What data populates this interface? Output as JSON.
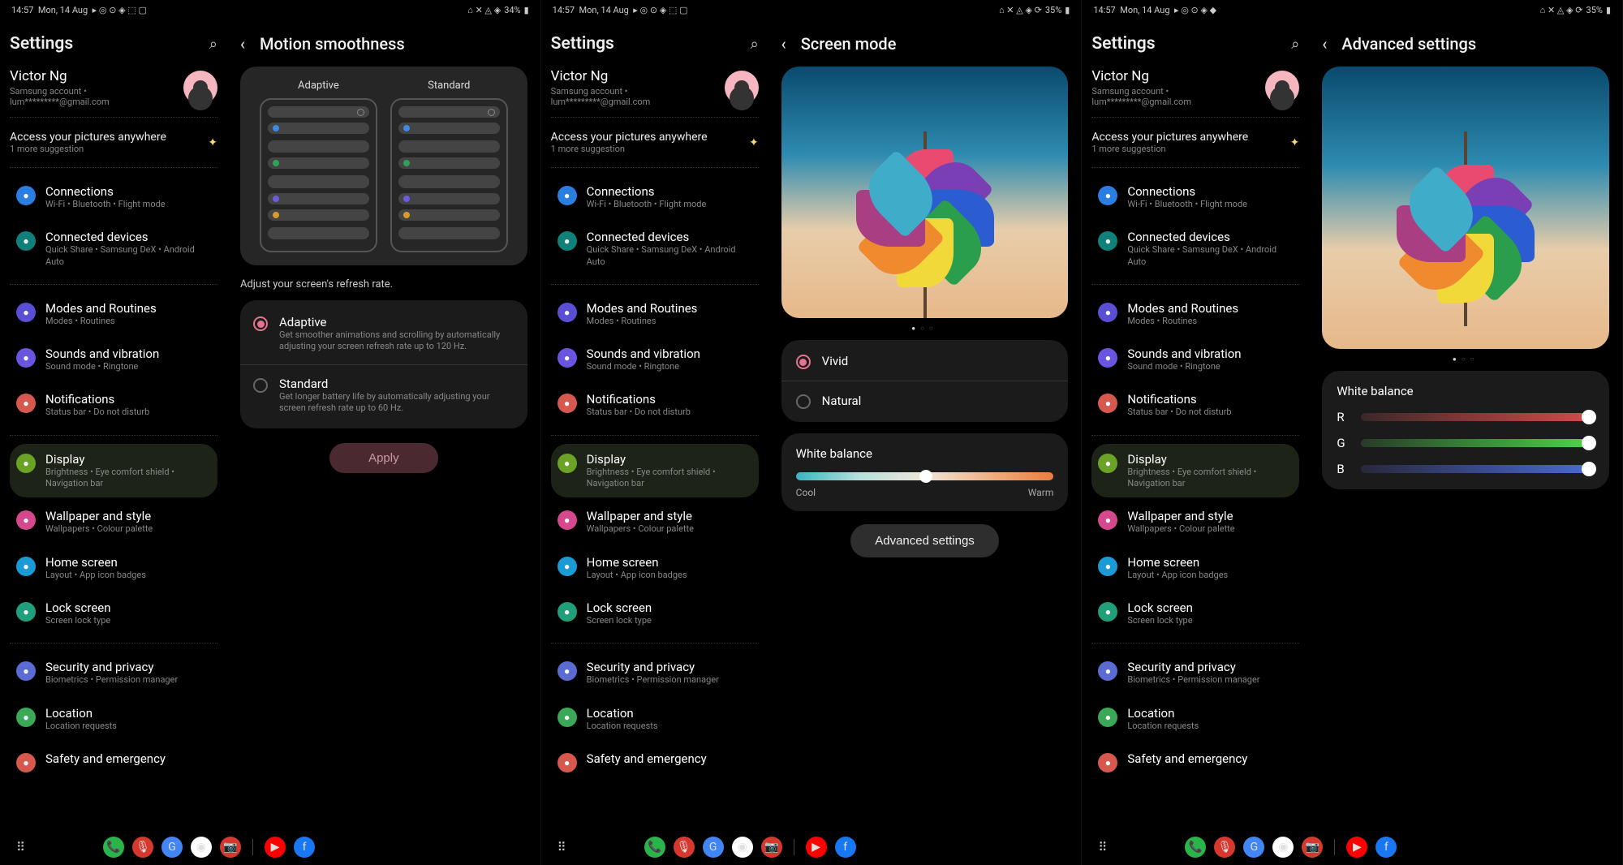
{
  "status": {
    "time": "14:57",
    "date": "Mon, 14 Aug",
    "battery1": "34%",
    "battery2": "35%"
  },
  "sidebar": {
    "title": "Settings",
    "account_name": "Victor Ng",
    "account_line": "Samsung account  •",
    "account_email": "lum*********@gmail.com",
    "suggestion_title": "Access your pictures anywhere",
    "suggestion_sub": "1 more suggestion",
    "items": [
      {
        "label": "Connections",
        "sub": "Wi-Fi  •  Bluetooth  •  Flight mode",
        "color": "#2a7de1"
      },
      {
        "label": "Connected devices",
        "sub": "Quick Share  •  Samsung DeX  •  Android Auto",
        "color": "#10807a"
      },
      {
        "label": "Modes and Routines",
        "sub": "Modes  •  Routines",
        "color": "#5a4ed4"
      },
      {
        "label": "Sounds and vibration",
        "sub": "Sound mode  •  Ringtone",
        "color": "#6a55e0"
      },
      {
        "label": "Notifications",
        "sub": "Status bar  •  Do not disturb",
        "color": "#d6584e"
      },
      {
        "label": "Display",
        "sub": "Brightness  •  Eye comfort shield  •  Navigation bar",
        "color": "#6aa326"
      },
      {
        "label": "Wallpaper and style",
        "sub": "Wallpapers  •  Colour palette",
        "color": "#d6488e"
      },
      {
        "label": "Home screen",
        "sub": "Layout  •  App icon badges",
        "color": "#1a9bd6"
      },
      {
        "label": "Lock screen",
        "sub": "Screen lock type",
        "color": "#1fa07a"
      },
      {
        "label": "Security and privacy",
        "sub": "Biometrics  •  Permission manager",
        "color": "#5a6cd4"
      },
      {
        "label": "Location",
        "sub": "Location requests",
        "color": "#3aa857"
      },
      {
        "label": "Safety and emergency",
        "sub": "",
        "color": "#d6584e"
      }
    ]
  },
  "motion": {
    "title": "Motion smoothness",
    "adaptive_tab": "Adaptive",
    "standard_tab": "Standard",
    "hint": "Adjust your screen's refresh rate.",
    "opt1_title": "Adaptive",
    "opt1_desc": "Get smoother animations and scrolling by automatically adjusting your screen refresh rate up to 120 Hz.",
    "opt2_title": "Standard",
    "opt2_desc": "Get longer battery life by automatically adjusting your screen refresh rate up to 60 Hz.",
    "apply": "Apply"
  },
  "screenmode": {
    "title": "Screen mode",
    "vivid": "Vivid",
    "natural": "Natural",
    "wb_title": "White balance",
    "cool": "Cool",
    "warm": "Warm",
    "adv_btn": "Advanced settings"
  },
  "advanced": {
    "title": "Advanced settings",
    "wb_title": "White balance",
    "r": "R",
    "g": "G",
    "b": "B"
  }
}
